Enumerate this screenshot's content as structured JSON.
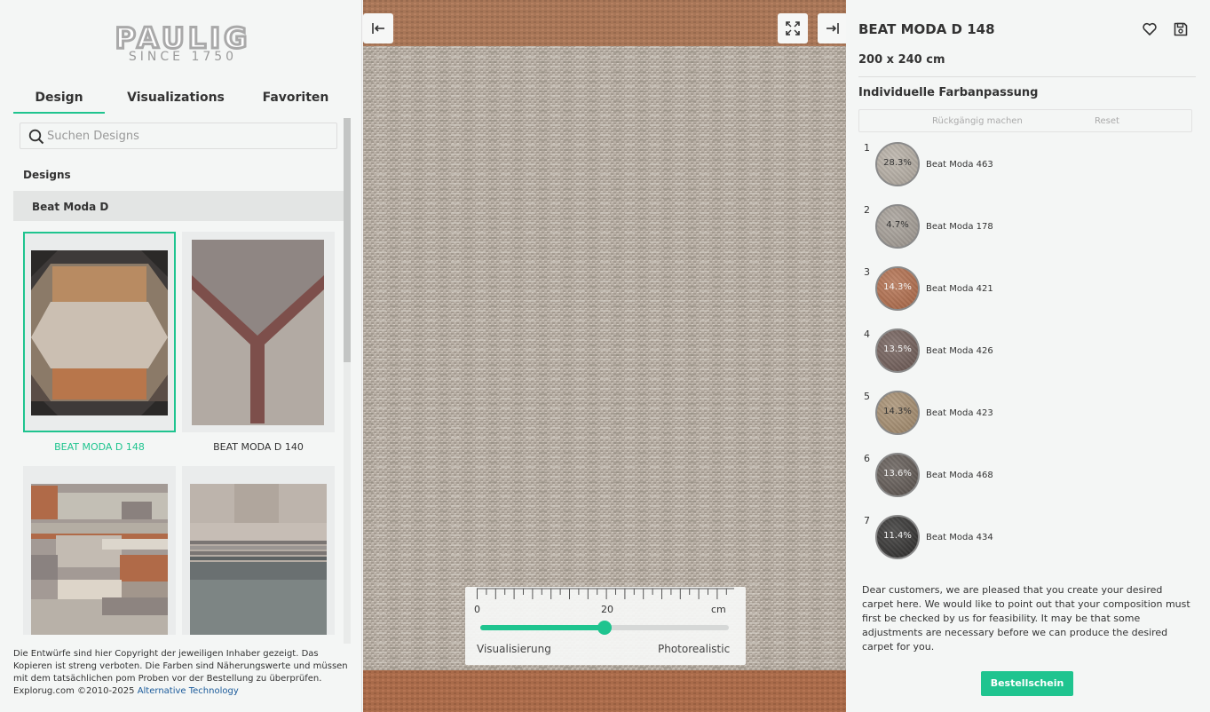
{
  "brand": {
    "logo_word": "PAULIG",
    "logo_since": "SINCE 1750"
  },
  "tabs": [
    {
      "label": "Design",
      "active": true
    },
    {
      "label": "Visualizations",
      "active": false
    },
    {
      "label": "Favoriten",
      "active": false
    }
  ],
  "search": {
    "placeholder": "Suchen Designs",
    "icon": "search-icon"
  },
  "designs": {
    "section_label": "Designs",
    "group_label": "Beat Moda D",
    "items": [
      {
        "label": "BEAT MODA D 148",
        "selected": true
      },
      {
        "label": "BEAT MODA D 140",
        "selected": false
      }
    ]
  },
  "footer": {
    "text": "Die Entwürfe sind hier Copyright der jeweiligen Inhaber gezeigt. Das Kopieren ist streng verboten. Die Farben sind Näherungswerte und müssen mit dem tatsächlichen pom Proben vor der Bestellung zu überprüfen.",
    "copyright": "Explorug.com ©2010-2025",
    "link": "Alternative Technology"
  },
  "viewer": {
    "icons": [
      "collapse-left-icon",
      "fullscreen-icon",
      "collapse-right-icon"
    ],
    "scale": {
      "tick_labels": [
        "0",
        "20",
        "cm"
      ],
      "slider_value": 0.5,
      "left_label": "Visualisierung",
      "right_label": "Photorealistic"
    }
  },
  "product": {
    "title": "BEAT MODA D 148",
    "size": "200 x 240 cm",
    "icons": [
      "heart-icon",
      "save-icon"
    ],
    "custom_title": "Individuelle Farbanpassung",
    "undo_label": "Rückgängig machen",
    "reset_label": "Reset",
    "colors": [
      {
        "num": "1",
        "pct": "28.3%",
        "name": "Beat Moda 463",
        "color": "#b5ada3",
        "text_color": "#333333"
      },
      {
        "num": "2",
        "pct": "4.7%",
        "name": "Beat Moda 178",
        "color": "#a39c94",
        "text_color": "#333333"
      },
      {
        "num": "3",
        "pct": "14.3%",
        "name": "Beat Moda 421",
        "color": "#b06a48",
        "text_color": "#f2f2f2"
      },
      {
        "num": "4",
        "pct": "13.5%",
        "name": "Beat Moda 426",
        "color": "#6e5a55",
        "text_color": "#f2f2f2"
      },
      {
        "num": "5",
        "pct": "14.3%",
        "name": "Beat Moda 423",
        "color": "#a48b6c",
        "text_color": "#333333"
      },
      {
        "num": "6",
        "pct": "13.6%",
        "name": "Beat Moda 468",
        "color": "#5d5550",
        "text_color": "#f2f2f2"
      },
      {
        "num": "7",
        "pct": "11.4%",
        "name": "Beat Moda 434",
        "color": "#2e2d2c",
        "text_color": "#f2f2f2"
      }
    ],
    "notice": "Dear customers, we are pleased that you create your desired carpet here. We would like to point out that your composition must first be checked by us for feasibility. It may be that some adjustments are necessary before we can produce the desired carpet for you.",
    "order_button": "Bestellschein"
  },
  "accent_color": "#1fc48f"
}
